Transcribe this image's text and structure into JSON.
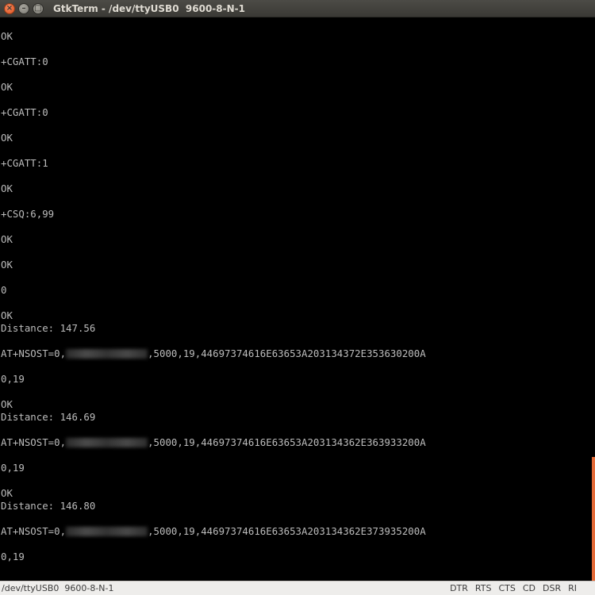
{
  "window": {
    "title": "GtkTerm - /dev/ttyUSB0  9600-8-N-1",
    "close_glyph": "×",
    "minimize_glyph": "–",
    "maximize_glyph": "□"
  },
  "terminal": {
    "lines": [
      {
        "pre": "OK"
      },
      {
        "pre": ""
      },
      {
        "pre": "+CGATT:0"
      },
      {
        "pre": ""
      },
      {
        "pre": "OK"
      },
      {
        "pre": ""
      },
      {
        "pre": "+CGATT:0"
      },
      {
        "pre": ""
      },
      {
        "pre": "OK"
      },
      {
        "pre": ""
      },
      {
        "pre": "+CGATT:1"
      },
      {
        "pre": ""
      },
      {
        "pre": "OK"
      },
      {
        "pre": ""
      },
      {
        "pre": "+CSQ:6,99"
      },
      {
        "pre": ""
      },
      {
        "pre": "OK"
      },
      {
        "pre": ""
      },
      {
        "pre": "OK"
      },
      {
        "pre": ""
      },
      {
        "pre": "0"
      },
      {
        "pre": ""
      },
      {
        "pre": "OK"
      },
      {
        "pre": "Distance: 147.56"
      },
      {
        "pre": ""
      },
      {
        "pre": "AT+NSOST=0,",
        "redacted": true,
        "post": ",5000,19,44697374616E63653A203134372E353630200A"
      },
      {
        "pre": ""
      },
      {
        "pre": "0,19"
      },
      {
        "pre": ""
      },
      {
        "pre": "OK"
      },
      {
        "pre": "Distance: 146.69"
      },
      {
        "pre": ""
      },
      {
        "pre": "AT+NSOST=0,",
        "redacted": true,
        "post": ",5000,19,44697374616E63653A203134362E363933200A"
      },
      {
        "pre": ""
      },
      {
        "pre": "0,19"
      },
      {
        "pre": ""
      },
      {
        "pre": "OK"
      },
      {
        "pre": "Distance: 146.80"
      },
      {
        "pre": ""
      },
      {
        "pre": "AT+NSOST=0,",
        "redacted": true,
        "post": ",5000,19,44697374616E63653A203134362E373935200A"
      },
      {
        "pre": ""
      },
      {
        "pre": "0,19"
      }
    ]
  },
  "statusbar": {
    "port": "/dev/ttyUSB0  9600-8-N-1",
    "signals": [
      "DTR",
      "RTS",
      "CTS",
      "CD",
      "DSR",
      "RI"
    ]
  },
  "colors": {
    "accent": "#e36a37",
    "terminal_bg": "#000000",
    "terminal_fg": "#bcbcbc"
  }
}
